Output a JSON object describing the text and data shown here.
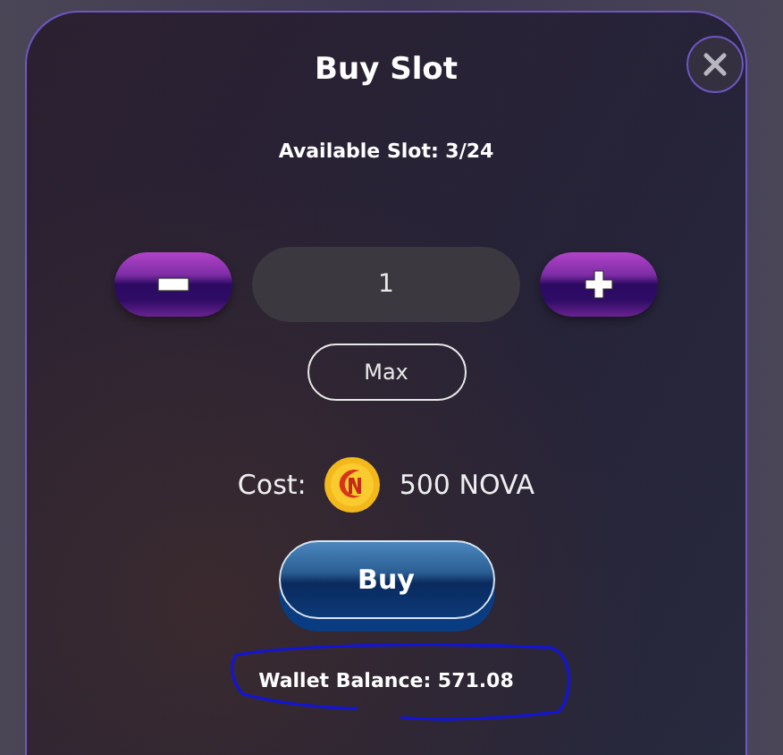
{
  "dialog": {
    "title": "Buy Slot",
    "available": "Available Slot: 3/24"
  },
  "quantity": {
    "value": "1",
    "max_label": "Max"
  },
  "cost": {
    "label": "Cost:",
    "amount": "500 NOVA"
  },
  "buy_button": "Buy",
  "wallet_balance": "Wallet Balance: 571.08"
}
